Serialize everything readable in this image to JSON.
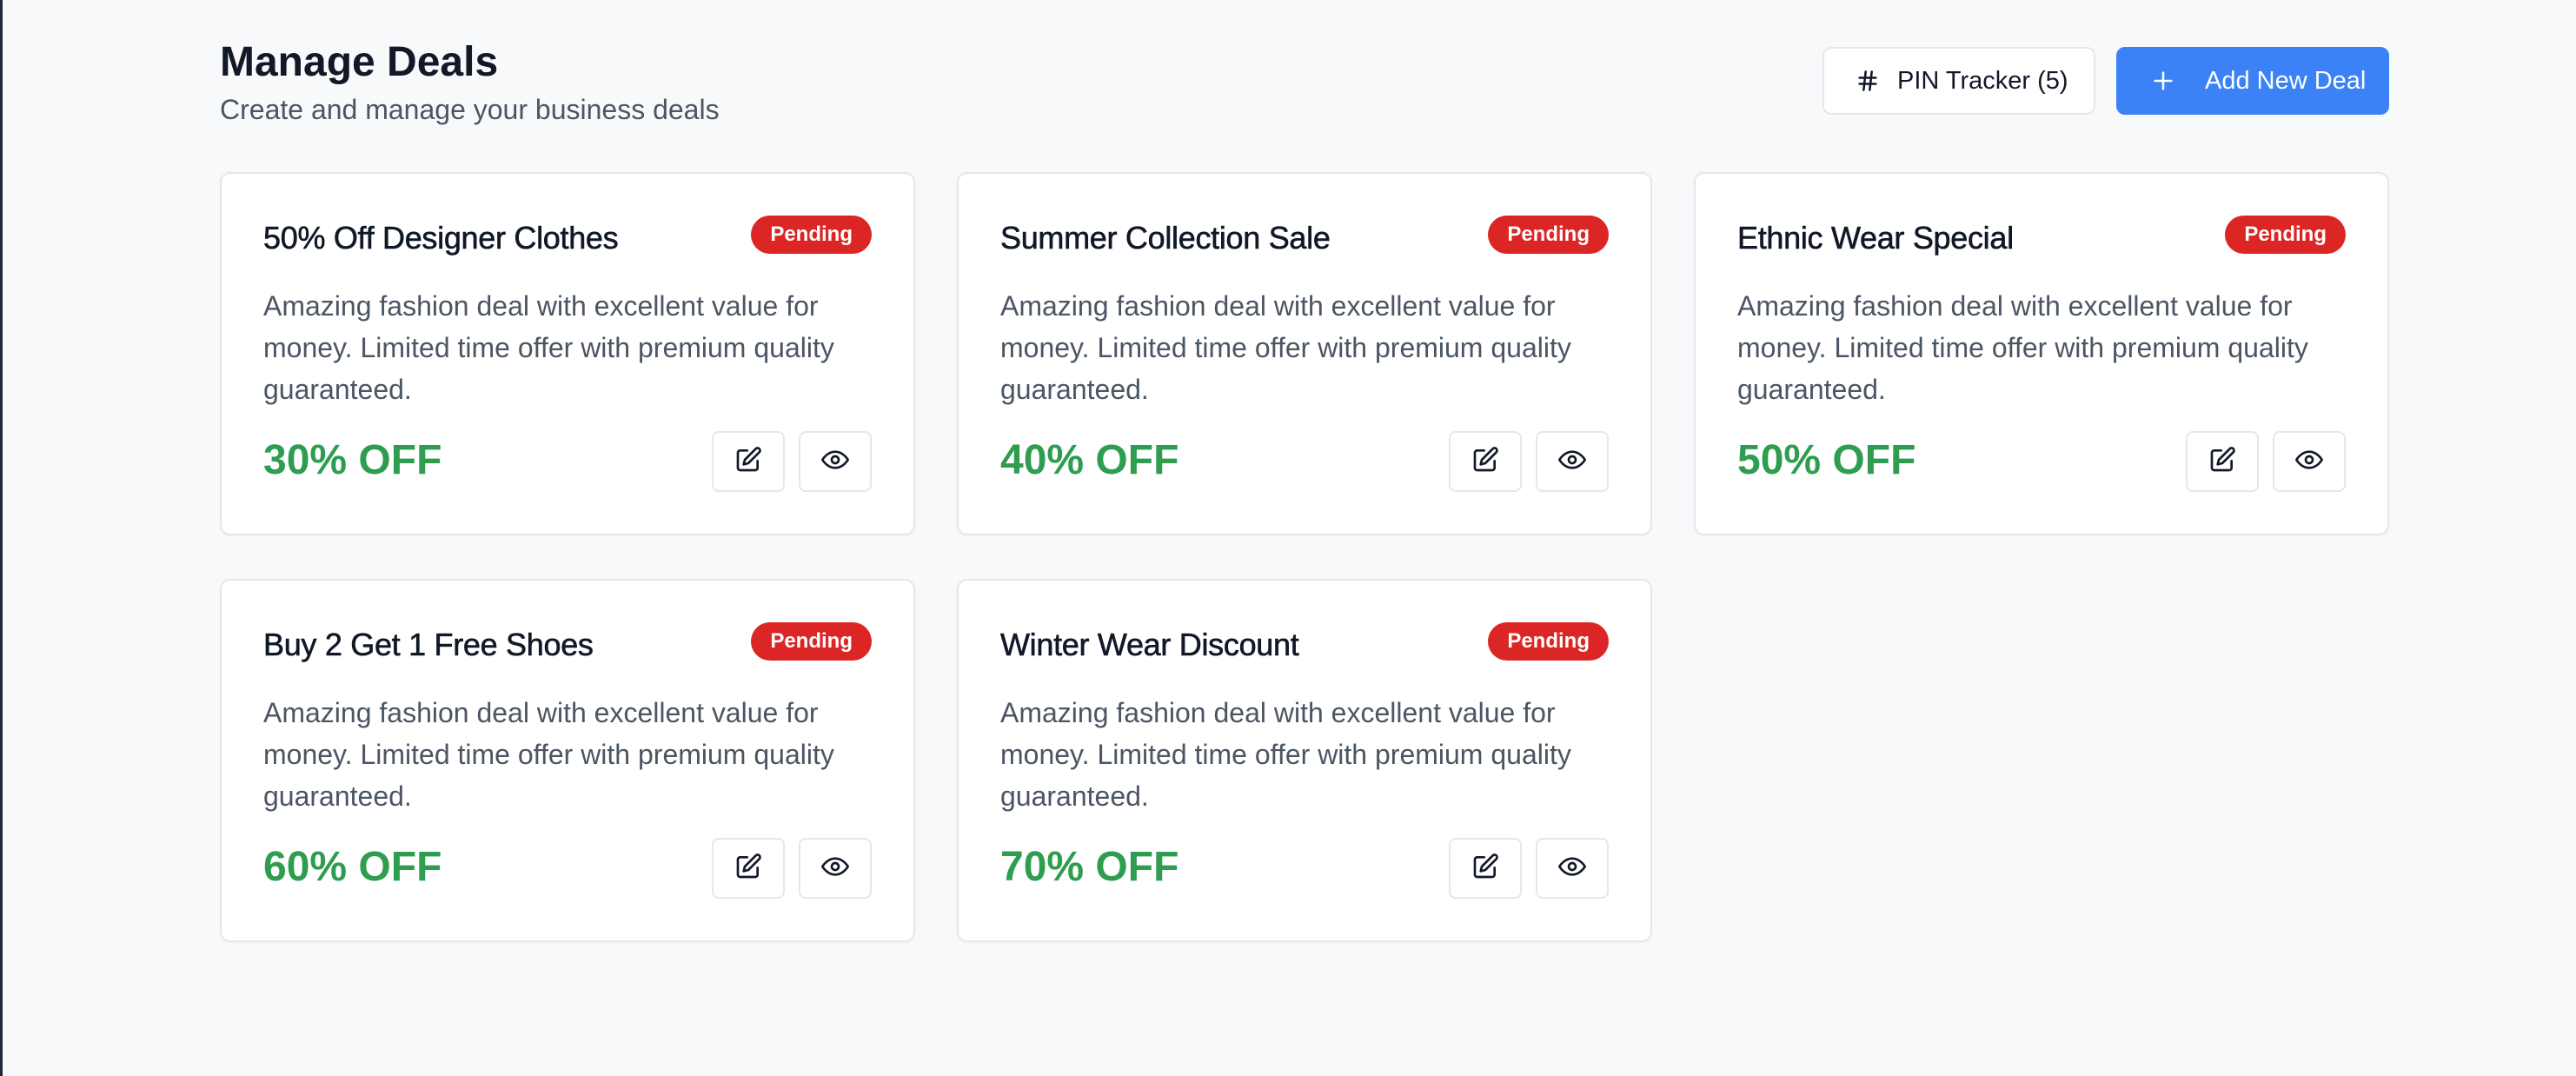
{
  "header": {
    "title": "Manage Deals",
    "subtitle": "Create and manage your business deals",
    "pin_tracker_label": "PIN Tracker (5)",
    "add_deal_label": "Add New Deal"
  },
  "colors": {
    "accent": "#3b82f6",
    "badge_pending": "#dc2626",
    "discount_green": "#2e9d4f"
  },
  "deals": [
    {
      "title": "50% Off Designer Clothes",
      "status": "Pending",
      "description": "Amazing fashion deal with excellent value for money. Limited time offer with premium quality guaranteed.",
      "discount": "30% OFF"
    },
    {
      "title": "Summer Collection Sale",
      "status": "Pending",
      "description": "Amazing fashion deal with excellent value for money. Limited time offer with premium quality guaranteed.",
      "discount": "40% OFF"
    },
    {
      "title": "Ethnic Wear Special",
      "status": "Pending",
      "description": "Amazing fashion deal with excellent value for money. Limited time offer with premium quality guaranteed.",
      "discount": "50% OFF"
    },
    {
      "title": "Buy 2 Get 1 Free Shoes",
      "status": "Pending",
      "description": "Amazing fashion deal with excellent value for money. Limited time offer with premium quality guaranteed.",
      "discount": "60% OFF"
    },
    {
      "title": "Winter Wear Discount",
      "status": "Pending",
      "description": "Amazing fashion deal with excellent value for money. Limited time offer with premium quality guaranteed.",
      "discount": "70% OFF"
    }
  ],
  "icons": {
    "pin_tracker": "hash-icon",
    "add_deal": "plus-icon",
    "edit": "edit-icon",
    "view": "eye-icon"
  }
}
